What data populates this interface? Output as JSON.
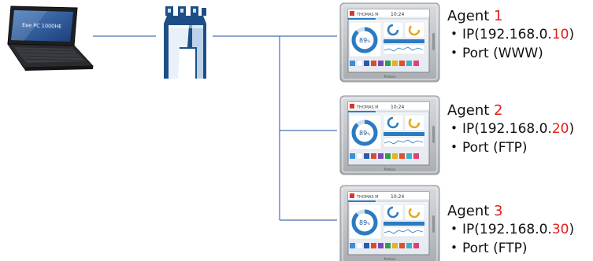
{
  "colors": {
    "link": "#4a6fb0",
    "accent_red": "#e0201b",
    "tower_blue": "#1d4f86",
    "hmi_frame": "#b9bcc0",
    "gauge_blue": "#2b7bc2"
  },
  "icons": {
    "laptop": "laptop-icon",
    "router": "castle-tower-icon",
    "hmi": "touch-panel-icon"
  },
  "laptop": {
    "brand": "Eee PC 1000HE"
  },
  "hmi": {
    "user": "THOMAS M",
    "time": "10:24",
    "gauge_value": "89",
    "gauge_unit": "%",
    "maker": "Proface"
  },
  "agents": [
    {
      "title_prefix": "Agent ",
      "number": "1",
      "ip_prefix": "IP(192.168.0.",
      "ip_suffix": "10",
      "ip_close": ")",
      "port": "Port  (WWW)"
    },
    {
      "title_prefix": "Agent ",
      "number": "2",
      "ip_prefix": "IP(192.168.0.",
      "ip_suffix": "20",
      "ip_close": ")",
      "port": "Port  (FTP)"
    },
    {
      "title_prefix": "Agent ",
      "number": "3",
      "ip_prefix": "IP(192.168.0.",
      "ip_suffix": "30",
      "ip_close": ")",
      "port": "Port  (FTP)"
    }
  ]
}
